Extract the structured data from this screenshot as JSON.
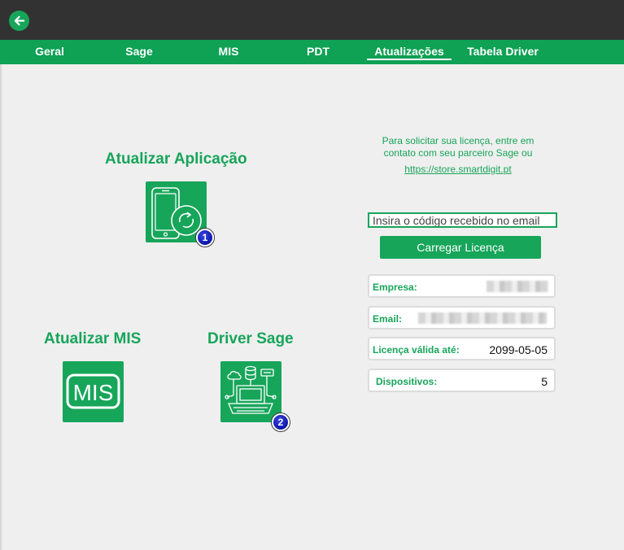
{
  "tabs": [
    {
      "label": "Geral"
    },
    {
      "label": "Sage"
    },
    {
      "label": "MIS"
    },
    {
      "label": "PDT"
    },
    {
      "label": "Atualizações",
      "active": true
    },
    {
      "label": "Tabela Driver"
    }
  ],
  "sections": {
    "update_app": {
      "title": "Atualizar Aplicação",
      "badge": "1",
      "icon": "phone-update-icon"
    },
    "update_mis": {
      "title": "Atualizar MIS",
      "icon_text": "MIS"
    },
    "driver_sage": {
      "title": "Driver Sage",
      "badge": "2",
      "icon": "server-network-icon"
    }
  },
  "license": {
    "info_line1": "Para solicitar sua licença, entre em",
    "info_line2": "contato com seu parceiro Sage ou",
    "link": "https://store.smartdigit.pt",
    "code_placeholder": "Insira o código recebido no email",
    "load_button": "Carregar Licença",
    "fields": {
      "company_label": "Empresa:",
      "email_label": "Email:",
      "valid_until_label": "Licença válida até:",
      "valid_until_value": "2099-05-05",
      "devices_label": "Dispositivos:",
      "devices_value": "5"
    }
  },
  "colors": {
    "accent": "#17a55a",
    "topbar": "#323232",
    "tabbar": "#0fa154",
    "badge": "#0d16a8"
  }
}
